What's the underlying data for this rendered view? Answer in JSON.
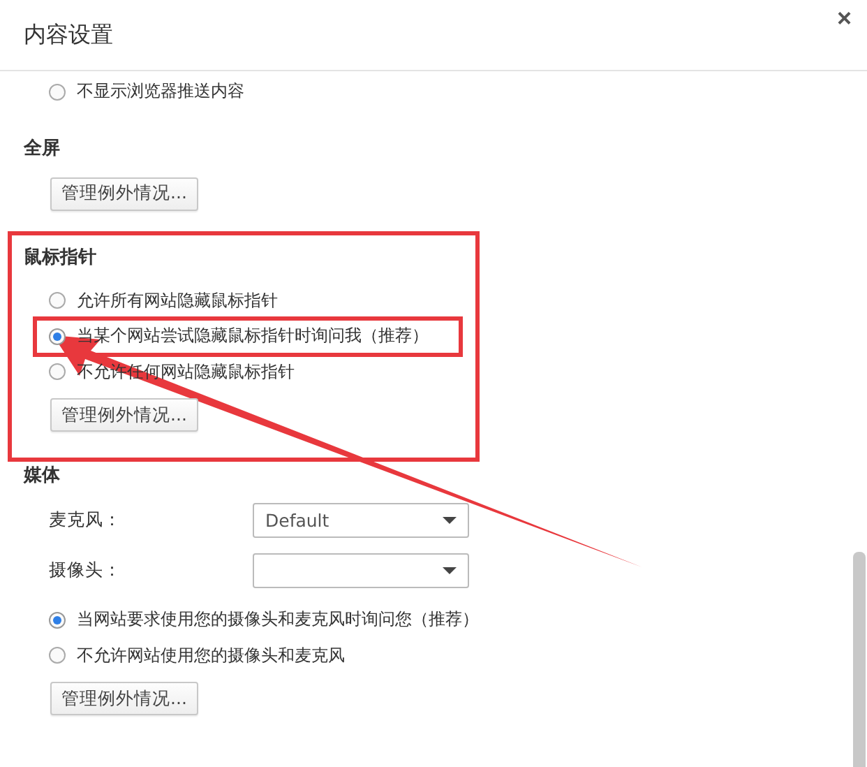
{
  "dialog": {
    "title": "内容设置",
    "close": "×"
  },
  "sections": [
    {
      "items": [
        {
          "kind": "radio",
          "label": "不显示浏览器推送内容",
          "selected": false
        }
      ]
    },
    {
      "heading": "全屏",
      "items": [
        {
          "kind": "button",
          "label": "管理例外情况..."
        }
      ]
    },
    {
      "heading": "鼠标指针",
      "items": [
        {
          "kind": "radio",
          "label": "允许所有网站隐藏鼠标指针",
          "selected": false
        },
        {
          "kind": "radio",
          "label": "当某个网站尝试隐藏鼠标指针时询问我（推荐）",
          "selected": true
        },
        {
          "kind": "radio",
          "label": "不允许任何网站隐藏鼠标指针",
          "selected": false
        },
        {
          "kind": "button",
          "label": "管理例外情况..."
        }
      ]
    },
    {
      "heading": "媒体",
      "items": [
        {
          "kind": "select",
          "label": "麦克风：",
          "value": "Default"
        },
        {
          "kind": "select",
          "label": "摄像头："
        },
        {
          "kind": "radio",
          "label": "当网站要求使用您的摄像头和麦克风时询问您（推荐）",
          "selected": true
        },
        {
          "kind": "radio",
          "label": "不允许网站使用您的摄像头和麦克风",
          "selected": false
        },
        {
          "kind": "button",
          "label": "管理例外情况..."
        }
      ]
    }
  ]
}
